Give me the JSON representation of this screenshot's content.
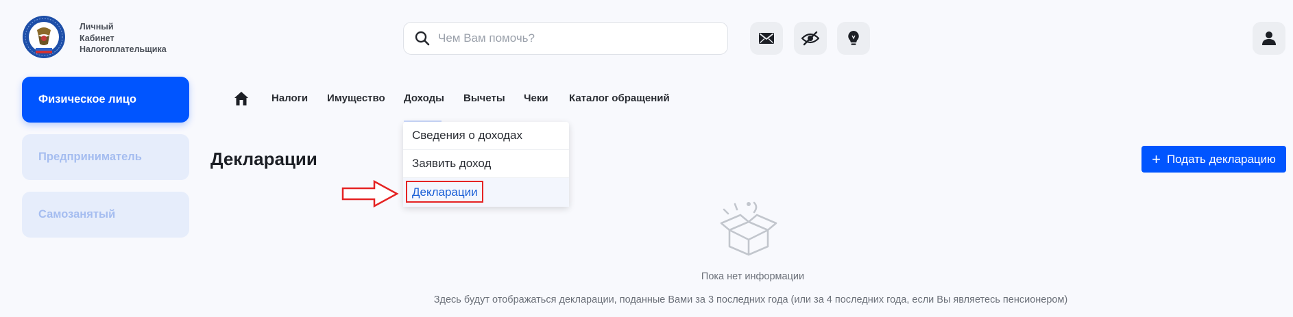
{
  "brand": {
    "line1": "Личный",
    "line2": "Кабинет",
    "line3": "Налогоплательщика",
    "logo_icon": "fns-emblem-icon"
  },
  "search": {
    "placeholder": "Чем Вам помочь?",
    "icon": "search-icon"
  },
  "header_buttons": [
    {
      "name": "mail",
      "icon": "envelope-icon"
    },
    {
      "name": "visually-impaired",
      "icon": "eye-off-icon"
    },
    {
      "name": "tips",
      "icon": "lightbulb-icon"
    },
    {
      "name": "profile",
      "icon": "user-icon"
    }
  ],
  "sidebar": {
    "items": [
      {
        "label": "Физическое лицо",
        "active": true
      },
      {
        "label": "Предприниматель",
        "active": false
      },
      {
        "label": "Самозанятый",
        "active": false
      }
    ]
  },
  "nav": {
    "home_icon": "home-icon",
    "items": [
      {
        "label": "Налоги"
      },
      {
        "label": "Имущество"
      },
      {
        "label": "Доходы",
        "open": true
      },
      {
        "label": "Вычеты"
      },
      {
        "label": "Чеки"
      },
      {
        "label": "Каталог обращений"
      }
    ]
  },
  "dropdown": {
    "items": [
      {
        "label": "Сведения о доходах"
      },
      {
        "label": "Заявить доход"
      },
      {
        "label": "Декларации",
        "selected": true
      }
    ]
  },
  "main": {
    "title": "Декларации",
    "submit_button": {
      "icon": "+",
      "label": "Подать декларацию"
    },
    "empty": {
      "icon": "empty-box-icon",
      "title": "Пока нет информации",
      "hint": "Здесь будут отображаться декларации, поданные Вами за 3 последних года (или за 4 последних года, если Вы являетесь пенсионером)"
    }
  },
  "colors": {
    "accent": "#0055ff",
    "highlight": "#e52323",
    "background": "#f8f9fd"
  }
}
